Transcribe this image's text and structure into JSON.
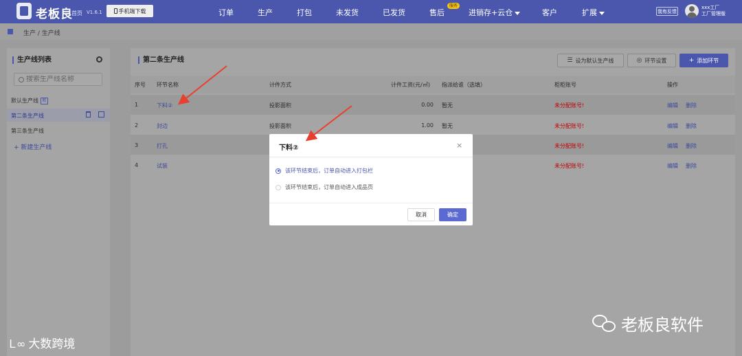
{
  "header": {
    "brand": "老板良",
    "home": "首页",
    "version": "V1.6.1",
    "mobile_download": "手机端下载",
    "nav": [
      "订单",
      "生产",
      "打包",
      "未发货",
      "已发货",
      "售后",
      "进销存+云仓",
      "客户",
      "扩展"
    ],
    "after_sale_badge": "服务",
    "feedback": "我有反馈",
    "user_line1": "xxx工厂",
    "user_line2": "工厂管理版"
  },
  "breadcrumb": "生产 / 生产线",
  "left_panel": {
    "title": "生产线列表",
    "search_placeholder": "搜索生产线名称",
    "lines": [
      {
        "name": "默认生产线",
        "tag": "默"
      },
      {
        "name": "第二条生产线"
      },
      {
        "name": "第三条生产线"
      }
    ],
    "new_line": "+ 新建生产线"
  },
  "main": {
    "title": "第二条生产线",
    "set_default": "设为默认生产线",
    "step_settings": "环节设置",
    "add_step": "添加环节",
    "columns": [
      "序号",
      "环节名称",
      "计件方式",
      "计件工资(元/㎡)",
      "指派给谁（选填）",
      "柜柜账号",
      "操作"
    ],
    "rows": [
      {
        "index": "1",
        "name": "下料②",
        "mode": "投影面积",
        "wage": "0.00",
        "assignee": "暂无",
        "account": "未分配账号!",
        "edit": "编辑",
        "delete": "删除"
      },
      {
        "index": "2",
        "name": "封边",
        "mode": "投影面积",
        "wage": "1.00",
        "assignee": "暂无",
        "account": "未分配账号!",
        "edit": "编辑",
        "delete": "删除"
      },
      {
        "index": "3",
        "name": "打孔",
        "mode": "",
        "wage": "",
        "assignee": "",
        "account": "未分配账号!",
        "edit": "编辑",
        "delete": "删除"
      },
      {
        "index": "4",
        "name": "试装",
        "mode": "",
        "wage": "",
        "assignee": "",
        "account": "未分配账号!",
        "edit": "编辑",
        "delete": "删除"
      }
    ]
  },
  "dialog": {
    "title": "下料②",
    "close": "×",
    "options": [
      {
        "label": "该环节结束后，订单自动进入打包栏",
        "checked": true
      },
      {
        "label": "该环节结束后，订单自动进入成品页",
        "checked": false
      }
    ],
    "cancel": "取消",
    "ok": "确定"
  },
  "watermarks": {
    "right": "老板良软件",
    "left_mark": "Ｌ∞",
    "left": "大数跨境"
  },
  "colors": {
    "nav_bg": "#4a57ad",
    "primary": "#5b6ad0",
    "danger": "#c00000",
    "arrow": "#e8402e"
  }
}
